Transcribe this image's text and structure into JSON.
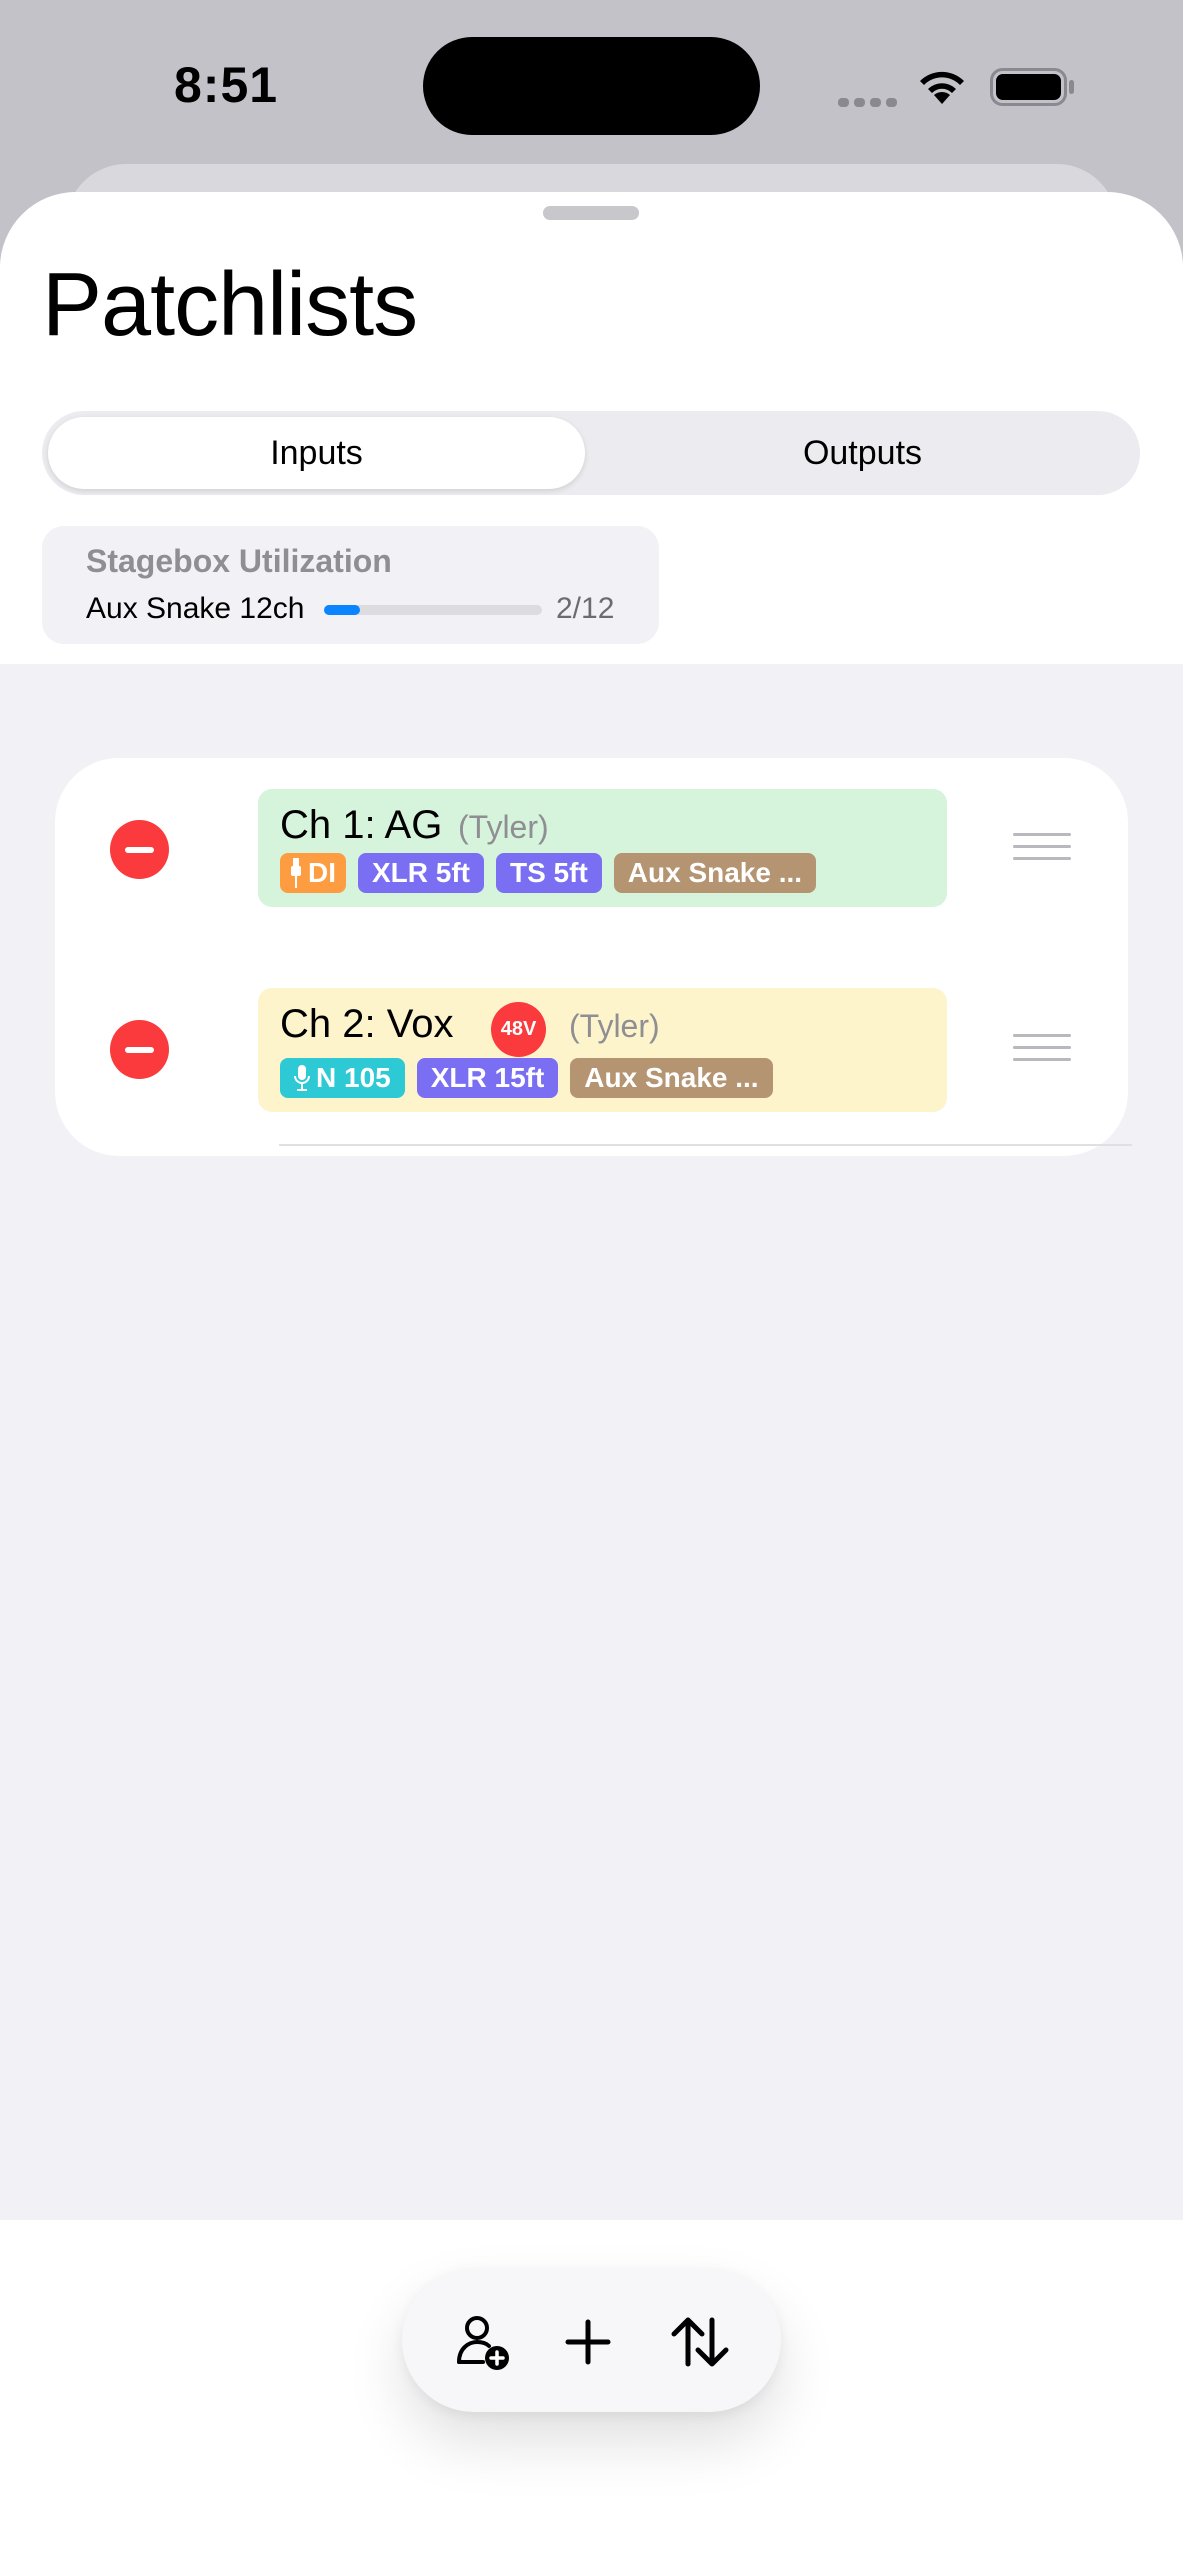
{
  "status_bar": {
    "time": "8:51"
  },
  "sheet": {
    "title": "Patchlists",
    "segments": [
      "Inputs",
      "Outputs"
    ],
    "selected_segment": "Inputs"
  },
  "utilization": {
    "title": "Stagebox Utilization",
    "stagebox": "Aux Snake 12ch",
    "count": "2/12",
    "used": 2,
    "total": 12,
    "fill_color": "#0a84ff"
  },
  "channels": [
    {
      "name": "Ch 1: AG",
      "owner": "(Tyler)",
      "color": "#d6f3dc",
      "tags": [
        {
          "label": "DI",
          "icon": "di-plug-icon",
          "color": "#fd9c40"
        },
        {
          "label": "XLR 5ft",
          "color": "#7a6ef3"
        },
        {
          "label": "TS 5ft",
          "color": "#7a6ef3"
        },
        {
          "label": "Aux Snake ...",
          "color": "#b59472"
        }
      ]
    },
    {
      "name": "Ch 2: Vox",
      "phantom": "48V",
      "owner": "(Tyler)",
      "color": "#fdf4cc",
      "tags": [
        {
          "label": "N 105",
          "icon": "microphone-icon",
          "color": "#2dc9d5"
        },
        {
          "label": "XLR 15ft",
          "color": "#7a6ef3"
        },
        {
          "label": "Aux Snake ...",
          "color": "#b59472"
        }
      ]
    }
  ],
  "toolbar": {
    "buttons": [
      "add-person-icon",
      "plus-icon",
      "sort-icon"
    ]
  },
  "colors": {
    "delete": "#fa3a3c",
    "accent": "#0a84ff"
  }
}
